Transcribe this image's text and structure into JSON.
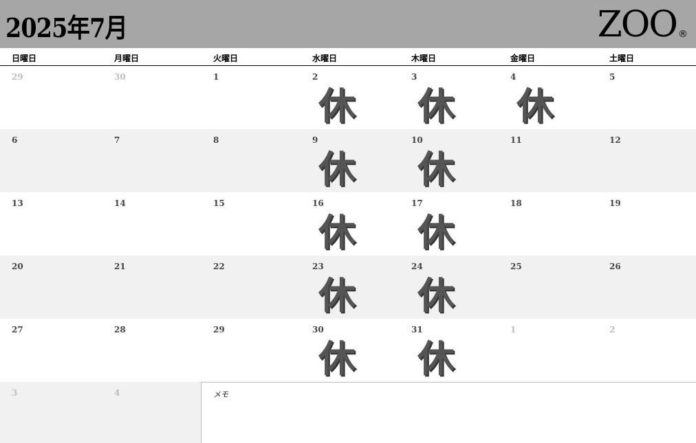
{
  "header": {
    "title": "2025年7月",
    "logo_text": "ZOO",
    "logo_mark": "®"
  },
  "weekdays": [
    "日曜日",
    "月曜日",
    "火曜日",
    "水曜日",
    "木曜日",
    "金曜日",
    "土曜日"
  ],
  "closed_label": "休",
  "weeks": [
    [
      {
        "day": "29",
        "other": true,
        "closed": false
      },
      {
        "day": "30",
        "other": true,
        "closed": false
      },
      {
        "day": "1",
        "other": false,
        "closed": false
      },
      {
        "day": "2",
        "other": false,
        "closed": true
      },
      {
        "day": "3",
        "other": false,
        "closed": true
      },
      {
        "day": "4",
        "other": false,
        "closed": true
      },
      {
        "day": "5",
        "other": false,
        "closed": false
      }
    ],
    [
      {
        "day": "6",
        "other": false,
        "closed": false
      },
      {
        "day": "7",
        "other": false,
        "closed": false
      },
      {
        "day": "8",
        "other": false,
        "closed": false
      },
      {
        "day": "9",
        "other": false,
        "closed": true
      },
      {
        "day": "10",
        "other": false,
        "closed": true
      },
      {
        "day": "11",
        "other": false,
        "closed": false
      },
      {
        "day": "12",
        "other": false,
        "closed": false
      }
    ],
    [
      {
        "day": "13",
        "other": false,
        "closed": false
      },
      {
        "day": "14",
        "other": false,
        "closed": false
      },
      {
        "day": "15",
        "other": false,
        "closed": false
      },
      {
        "day": "16",
        "other": false,
        "closed": true
      },
      {
        "day": "17",
        "other": false,
        "closed": true
      },
      {
        "day": "18",
        "other": false,
        "closed": false
      },
      {
        "day": "19",
        "other": false,
        "closed": false
      }
    ],
    [
      {
        "day": "20",
        "other": false,
        "closed": false
      },
      {
        "day": "21",
        "other": false,
        "closed": false
      },
      {
        "day": "22",
        "other": false,
        "closed": false
      },
      {
        "day": "23",
        "other": false,
        "closed": true
      },
      {
        "day": "24",
        "other": false,
        "closed": true
      },
      {
        "day": "25",
        "other": false,
        "closed": false
      },
      {
        "day": "26",
        "other": false,
        "closed": false
      }
    ],
    [
      {
        "day": "27",
        "other": false,
        "closed": false
      },
      {
        "day": "28",
        "other": false,
        "closed": false
      },
      {
        "day": "29",
        "other": false,
        "closed": false
      },
      {
        "day": "30",
        "other": false,
        "closed": true
      },
      {
        "day": "31",
        "other": false,
        "closed": true
      },
      {
        "day": "1",
        "other": true,
        "closed": false
      },
      {
        "day": "2",
        "other": true,
        "closed": false
      }
    ]
  ],
  "extra_days": [
    {
      "day": "3",
      "other": true
    },
    {
      "day": "4",
      "other": true
    }
  ],
  "memo": {
    "label": "メモ"
  },
  "colors": {
    "header_bg": "#a6a6a6",
    "shaded_row": "#f1f1f1",
    "closed_mark": "#555555",
    "other_month_text": "#bdbdbd"
  }
}
